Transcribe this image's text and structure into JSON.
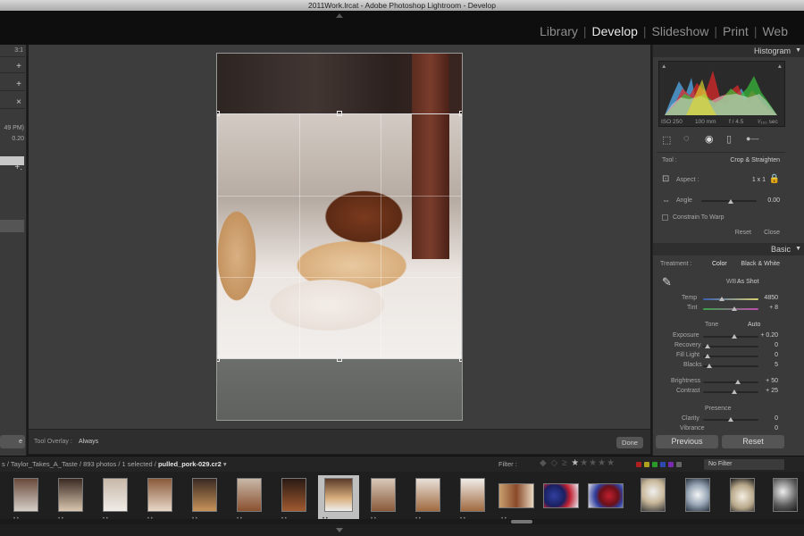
{
  "window": {
    "title": "2011Work.lrcat - Adobe Photoshop Lightroom - Develop"
  },
  "modules": [
    {
      "label": "Library",
      "active": false
    },
    {
      "label": "Develop",
      "active": true
    },
    {
      "label": "Slideshow",
      "active": false
    },
    {
      "label": "Print",
      "active": false
    },
    {
      "label": "Web",
      "active": false
    }
  ],
  "left_panel": {
    "texts": [
      "3:1",
      "49 PM)",
      "0.20"
    ],
    "button_label": "e"
  },
  "histogram": {
    "title": "Histogram",
    "iso": "ISO 250",
    "focal": "100 mm",
    "aperture": "f / 4.5",
    "shutter": "¹⁄₁₀₀ sec"
  },
  "crop": {
    "tool_label": "Tool :",
    "tool_name": "Crop & Straighten",
    "aspect_label": "Aspect :",
    "aspect_value": "1 x 1",
    "angle_label": "Angle",
    "angle_value": "0.00",
    "warp_label": "Constrain To Warp",
    "reset_label": "Reset",
    "close_label": "Close"
  },
  "basic": {
    "title": "Basic",
    "treatment_label": "Treatment :",
    "treatment_color": "Color",
    "treatment_bw": "Black & White",
    "wb_label": "WB :",
    "wb_value": "As Shot",
    "temp_label": "Temp",
    "temp_value": "4850",
    "tint_label": "Tint",
    "tint_value": "+ 8",
    "tone_label": "Tone",
    "auto_label": "Auto",
    "tone_rows": [
      {
        "label": "Exposure",
        "value": "+ 0.20"
      },
      {
        "label": "Recovery",
        "value": "0"
      },
      {
        "label": "Fill Light",
        "value": "0"
      },
      {
        "label": "Blacks",
        "value": "5"
      }
    ],
    "tone_rows2": [
      {
        "label": "Brightness",
        "value": "+ 50"
      },
      {
        "label": "Contrast",
        "value": "+ 25"
      }
    ],
    "presence_label": "Presence",
    "presence_rows": [
      {
        "label": "Clarity",
        "value": "0"
      },
      {
        "label": "Vibrance",
        "value": "0"
      }
    ]
  },
  "footer_buttons": {
    "previous": "Previous",
    "reset": "Reset"
  },
  "tool_overlay": {
    "label": "Tool Overlay :",
    "value": "Always",
    "done": "Done"
  },
  "filmstrip_header": {
    "path_prefix": "s / Taylor_Takes_A_Taste / 893 photos / 1 selected / ",
    "filename": "pulled_pork-029.cr2",
    "filter_label": "Filter :",
    "no_filter": "No Filter"
  },
  "colors": {
    "panel_bg": "#3a3a3a",
    "canvas_bg": "#3d3d3d",
    "label_red": "#b02020",
    "label_yellow": "#b0a020",
    "label_green": "#2a9a2a",
    "label_blue": "#2a4ab0",
    "label_purple": "#7a2ab0"
  }
}
